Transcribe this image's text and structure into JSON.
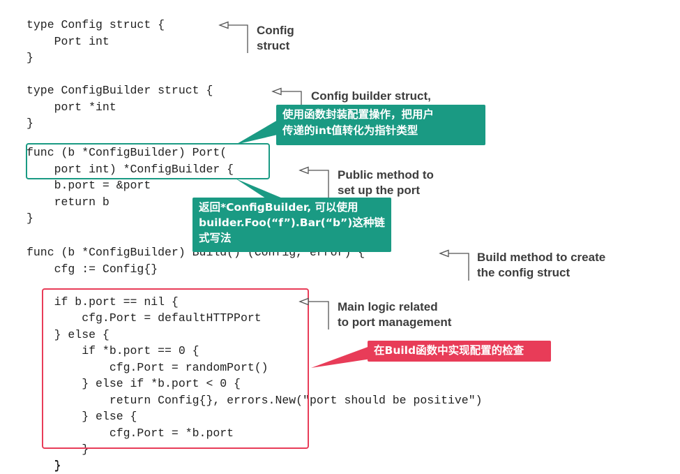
{
  "code_blocks": {
    "config_struct": "type Config struct {\n    Port int\n}",
    "builder_struct": "type ConfigBuilder struct {\n    port *int\n}",
    "port_method": "func (b *ConfigBuilder) Port(\n    port int) *ConfigBuilder {\n    b.port = &port\n    return b\n}",
    "build_method": "func (b *ConfigBuilder) Build() (Config, error) {\n    cfg := Config{}\n\n    if b.port == nil {\n        cfg.Port = defaultHTTPPort\n    } else {\n        if *b.port == 0 {\n            cfg.Port = randomPort()\n        } else if *b.port < 0 {\n            return Config{}, errors.New(\"port should be positive\")\n        } else {\n            cfg.Port = *b.port\n        }\n    }"
  },
  "annotations": {
    "config_struct": "Config\nstruct",
    "builder_struct": "Config builder struct,",
    "port_method": "Public method to\nset up the port",
    "build_method": "Build method to create\nthe config struct",
    "main_logic": "Main logic related\nto port management"
  },
  "callouts": {
    "builder_cn": "使用函数封装配置操作，把用户\n传递的int值转化为指针类型",
    "return_cn": "返回*ConfigBuilder, 可以使用\nbuilder.Foo(“f”).Bar(“b”)这种链\n式写法",
    "build_cn": "在Build函数中实现配置的检查"
  },
  "colors": {
    "teal_accent": "#1a9a83",
    "red_accent": "#e83c58",
    "arrow_gray": "#555555"
  }
}
